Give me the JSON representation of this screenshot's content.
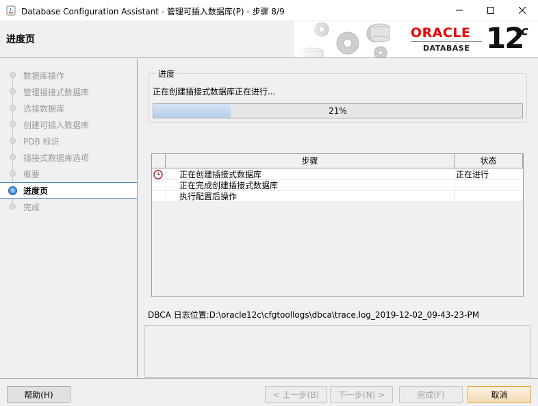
{
  "window": {
    "title": "Database Configuration Assistant - 管理可插入数据库(P) - 步骤 8/9"
  },
  "header": {
    "page_title": "进度页",
    "brand": {
      "oracle": "ORACLE",
      "database": "DATABASE",
      "version": "12",
      "version_suffix": "c"
    },
    "colors": {
      "oracle_red": "#e00000"
    }
  },
  "nav": {
    "items": [
      {
        "label": "数据库操作",
        "state": "done"
      },
      {
        "label": "管理插接式数据库",
        "state": "done"
      },
      {
        "label": "选择数据库",
        "state": "done"
      },
      {
        "label": "创建可插入数据库",
        "state": "done"
      },
      {
        "label": "PDB 标识",
        "state": "done"
      },
      {
        "label": "插接式数据库选项",
        "state": "done"
      },
      {
        "label": "概要",
        "state": "done"
      },
      {
        "label": "进度页",
        "state": "active"
      },
      {
        "label": "完成",
        "state": "pending"
      }
    ]
  },
  "progress": {
    "legend": "进度",
    "status": "正在创建插接式数据库正在进行...",
    "percent": 21,
    "percent_label": "21%"
  },
  "steps": {
    "headers": {
      "step": "步骤",
      "status": "状态"
    },
    "rows": [
      {
        "step": "正在创建插接式数据库",
        "status": "正在进行",
        "icon": "clock-icon"
      },
      {
        "step": "正在完成创建插接式数据库",
        "status": "",
        "icon": ""
      },
      {
        "step": "执行配置后操作",
        "status": "",
        "icon": ""
      }
    ]
  },
  "log": {
    "text": "DBCA 日志位置:D:\\oracle12c\\cfgtoollogs\\dbca\\trace.log_2019-12-02_09-43-23-PM"
  },
  "buttons": {
    "help": "帮助(H)",
    "back": "< 上一步(B)",
    "next": "下一步(N) >",
    "finish": "完成(F)",
    "cancel": "取消"
  }
}
